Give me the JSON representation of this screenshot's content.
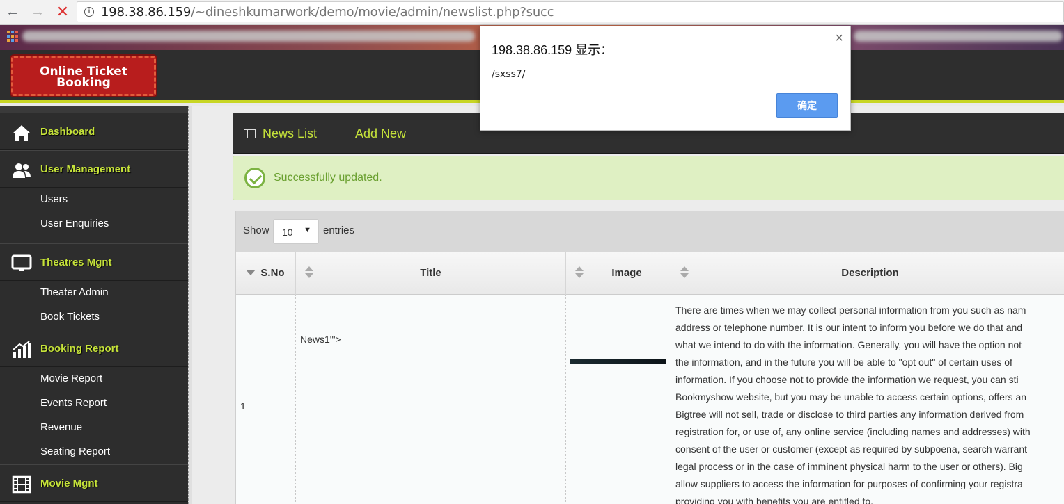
{
  "browser": {
    "back_glyph": "←",
    "forward_glyph": "→",
    "stop_glyph": "✕",
    "url_host": "198.38.86.159",
    "url_path": "/~dineshkumarwork/demo/movie/admin/newslist.php?succ"
  },
  "header": {
    "logo_line1": "Online Ticket",
    "logo_line2": "Booking"
  },
  "sidebar": {
    "sections": [
      {
        "label": "Dashboard",
        "icon": "home-icon",
        "items": []
      },
      {
        "label": "User Management",
        "icon": "users-icon",
        "items": [
          "Users",
          "User Enquiries"
        ]
      },
      {
        "label": "Theatres Mgnt",
        "icon": "monitor-icon",
        "items": [
          "Theater Admin",
          "Book Tickets"
        ]
      },
      {
        "label": "Booking Report",
        "icon": "bar-chart-icon",
        "items": [
          "Movie Report",
          "Events Report",
          "Revenue",
          "Seating Report"
        ]
      },
      {
        "label": "Movie Mgnt",
        "icon": "film-icon",
        "items": []
      }
    ]
  },
  "panel": {
    "tab_list": "News List",
    "tab_add": "Add New"
  },
  "alert": {
    "message": "Successfully updated."
  },
  "table": {
    "show_label": "Show",
    "entries_label": "entries",
    "page_size": "10",
    "columns": [
      "S.No",
      "Title",
      "Image",
      "Description"
    ],
    "rows": [
      {
        "sno": "1",
        "title": "News1'\">",
        "description_lines": [
          "There are times when we may collect personal information from you such as nam",
          "address or telephone number. It is our intent to inform you before we do that and",
          "what we intend to do with the information. Generally, you will have the option not",
          "the information, and in the future you will be able to \"opt out\" of certain uses of",
          "information. If you choose not to provide the information we request, you can sti",
          "Bookmyshow website, but you may be unable to access certain options, offers an",
          "Bigtree will not sell, trade or disclose to third parties any information derived from",
          "registration for, or use of, any online service (including names and addresses) with",
          "consent of the user or customer (except as required by subpoena, search warrant",
          "legal process or in the case of imminent physical harm to the user or others). Big",
          "allow suppliers to access the information for purposes of confirming your registra",
          "providing you with benefits you are entitled to."
        ]
      }
    ]
  },
  "dialog": {
    "title": "198.38.86.159 显示：",
    "message": "/sxss7/",
    "ok_label": "确定",
    "close_glyph": "×"
  },
  "colors": {
    "accent": "#c6e33a",
    "header_bg": "#2e2e2e",
    "success_bg": "#dff0c3",
    "ok_button": "#5b9bf0"
  }
}
